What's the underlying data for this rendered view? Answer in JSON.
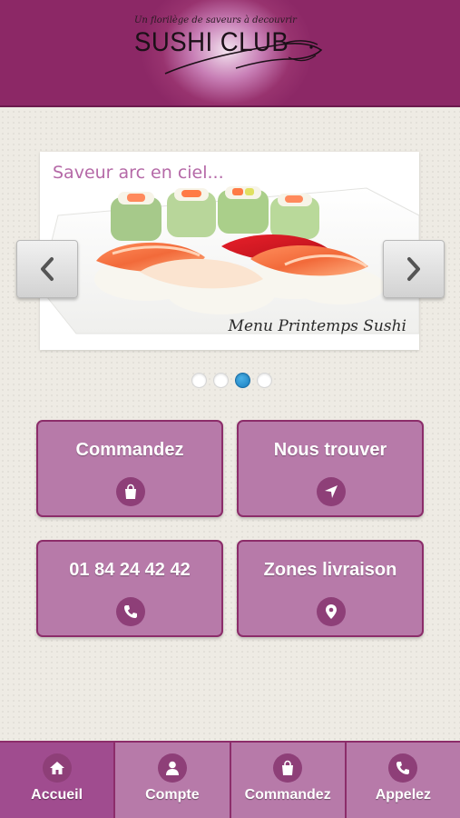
{
  "header": {
    "tagline": "Un florilège de saveurs à decouvrir",
    "logo_text": "SUSHI CLUB"
  },
  "slider": {
    "title": "Saveur arc en ciel...",
    "caption": "Menu Printemps Sushi",
    "active_index": 3,
    "slide_count": 4
  },
  "tiles": [
    {
      "label": "Commandez",
      "icon": "shopping-bag-icon"
    },
    {
      "label": "Nous trouver",
      "icon": "navigation-arrow-icon"
    },
    {
      "label": "01 84 24 42 42",
      "icon": "phone-icon"
    },
    {
      "label": "Zones livraison",
      "icon": "map-pin-icon"
    }
  ],
  "bottom_nav": [
    {
      "label": "Accueil",
      "icon": "home-icon",
      "active": true
    },
    {
      "label": "Compte",
      "icon": "user-icon",
      "active": false
    },
    {
      "label": "Commandez",
      "icon": "shopping-bag-icon",
      "active": false
    },
    {
      "label": "Appelez",
      "icon": "phone-icon",
      "active": false
    }
  ],
  "colors": {
    "brand_purple": "#8c2866",
    "tile_fill": "#b77aa9",
    "tile_border": "#8c2d6a",
    "active_dot": "#1a7fc0"
  }
}
